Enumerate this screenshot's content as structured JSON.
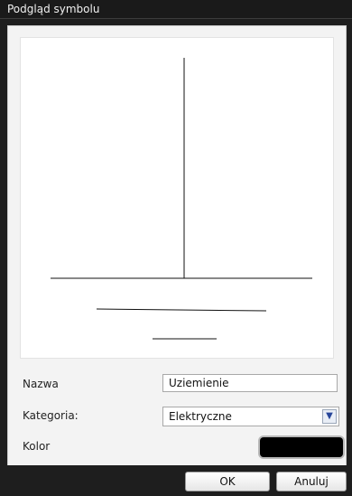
{
  "window": {
    "title": "Podgląd symbolu"
  },
  "form": {
    "name_label": "Nazwa",
    "name_value": "Uziemienie",
    "category_label": "Kategoria:",
    "category_value": "Elektryczne",
    "color_label": "Kolor",
    "color_value": "#000000"
  },
  "buttons": {
    "ok": "OK",
    "cancel": "Anuluj"
  },
  "icons": {
    "dropdown": "chevron-down-icon"
  },
  "colors": {
    "titlebar": "#1a1a1a",
    "panel": "#f3f3f3",
    "accent": "#27469a"
  }
}
